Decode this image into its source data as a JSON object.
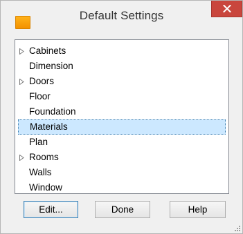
{
  "window": {
    "title": "Default Settings",
    "icon": "app-icon",
    "colors": {
      "close_button": "#c9463d",
      "selection_bg": "#cce8ff",
      "selection_border": "#3c7fb1",
      "app_icon": "#f39200"
    }
  },
  "list": {
    "items": [
      {
        "label": "Cabinets",
        "expandable": true
      },
      {
        "label": "Dimension",
        "expandable": false
      },
      {
        "label": "Doors",
        "expandable": true
      },
      {
        "label": "Floor",
        "expandable": false
      },
      {
        "label": "Foundation",
        "expandable": false
      },
      {
        "label": "Materials",
        "expandable": false,
        "selected": true
      },
      {
        "label": "Plan",
        "expandable": false
      },
      {
        "label": "Rooms",
        "expandable": true
      },
      {
        "label": "Walls",
        "expandable": false
      },
      {
        "label": "Window",
        "expandable": false
      }
    ]
  },
  "buttons": {
    "edit": "Edit...",
    "done": "Done",
    "help": "Help"
  }
}
